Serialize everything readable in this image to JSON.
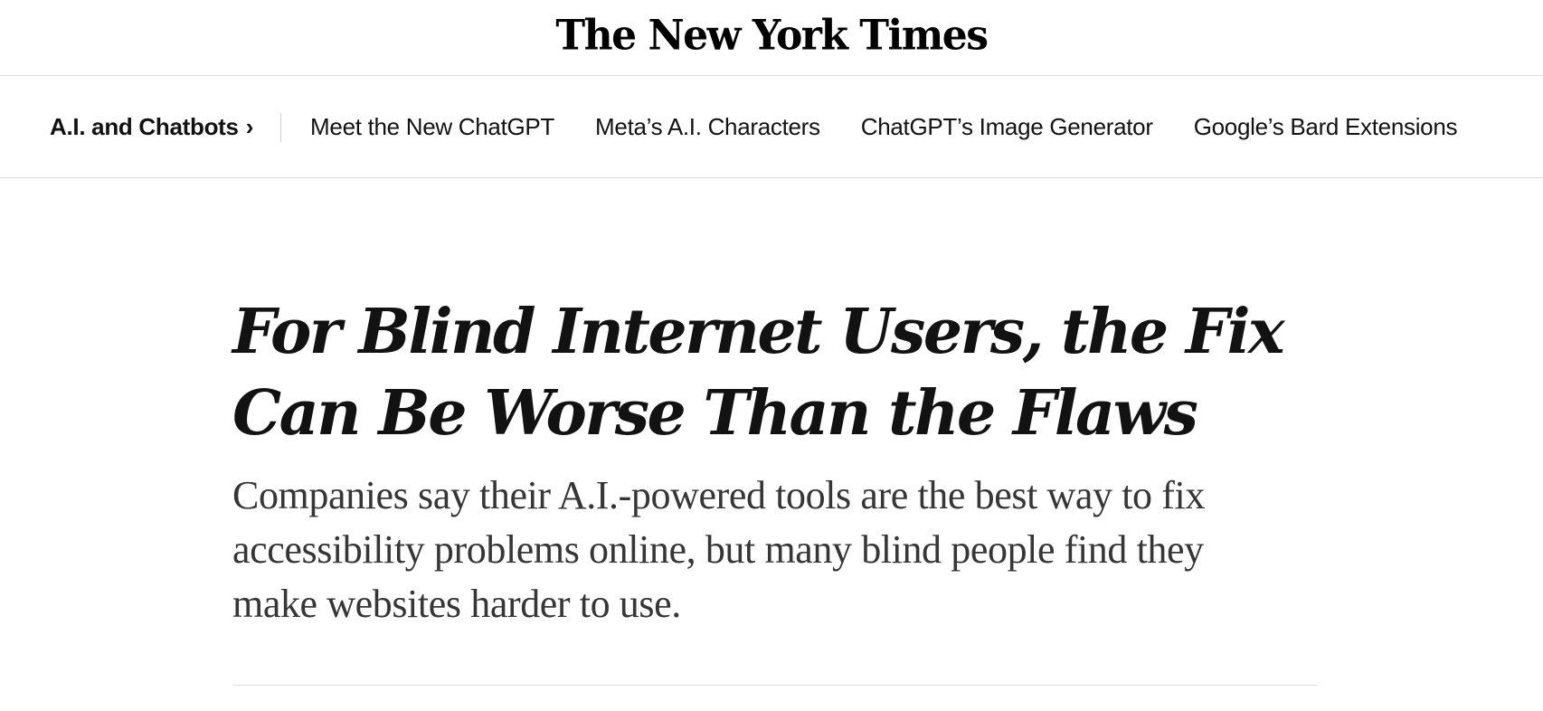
{
  "masthead": {
    "logo_text": "The New York Times"
  },
  "subnav": {
    "section_label": "A.I. and Chatbots",
    "section_chevron": "›",
    "links": [
      "Meet the New ChatGPT",
      "Meta’s A.I. Characters",
      "ChatGPT’s Image Generator",
      "Google’s Bard Extensions"
    ]
  },
  "article": {
    "headline": "For Blind Internet Users, the Fix Can Be Worse Than the Flaws",
    "summary": "Companies say their A.I.-powered tools are the best way to fix accessibility problems online, but many blind people find they make websites harder to use."
  }
}
